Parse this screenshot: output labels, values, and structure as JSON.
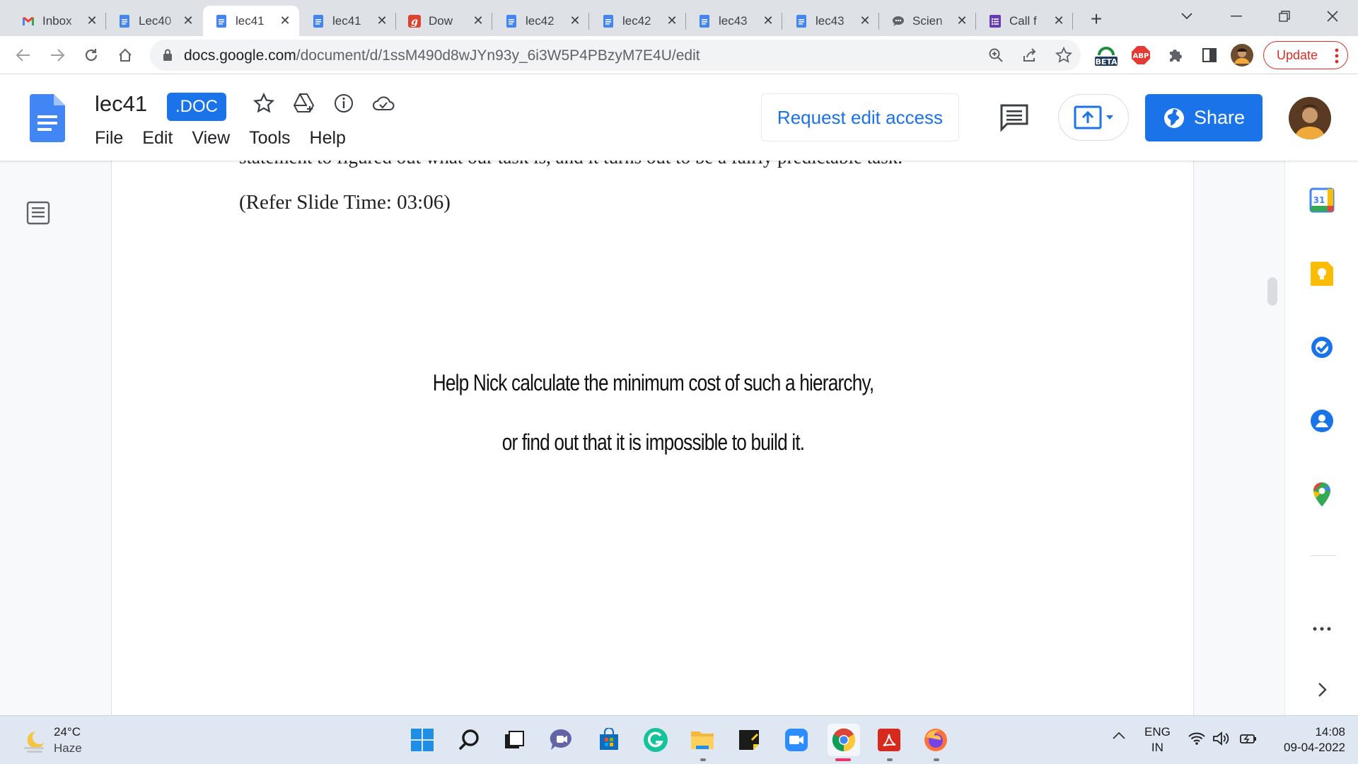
{
  "browser": {
    "tabs": [
      {
        "title": "Inbox",
        "favicon": "gmail-icon"
      },
      {
        "title": "Lec40",
        "favicon": "docs-icon"
      },
      {
        "title": "lec41",
        "favicon": "docs-icon",
        "active": true
      },
      {
        "title": "lec41",
        "favicon": "docs-icon"
      },
      {
        "title": "Dow",
        "favicon": "g-red-icon"
      },
      {
        "title": "lec42",
        "favicon": "docs-icon"
      },
      {
        "title": "lec42",
        "favicon": "docs-icon"
      },
      {
        "title": "lec43",
        "favicon": "docs-icon"
      },
      {
        "title": "lec43",
        "favicon": "docs-icon"
      },
      {
        "title": "Scien",
        "favicon": "chat-bubble-icon"
      },
      {
        "title": "Call f",
        "favicon": "forms-icon"
      }
    ],
    "url_host": "docs.google.com",
    "url_path": "/document/d/1ssM490d8wJYn93y_6i3W5P4PBzyM7E4U/edit",
    "extension_beta_label": "BETA",
    "extension_abp_label": "ABP",
    "update_label": "Update"
  },
  "docs": {
    "title": "lec41",
    "badge": ".DOC",
    "menu": [
      "File",
      "Edit",
      "View",
      "Tools",
      "Help"
    ],
    "request_edit_label": "Request edit access",
    "share_label": "Share"
  },
  "document": {
    "cut_line": "statement to figured out what our task is, and it turns out to be a fairly predictable task.",
    "refer_line": "(Refer Slide Time: 03:06)",
    "slide_line1": "Help Nick calculate the minimum cost of such a hierarchy,",
    "slide_line2": "or find out that it is impossible to build it."
  },
  "side_panel": {
    "calendar_day": "31"
  },
  "taskbar": {
    "weather_temp": "24°C",
    "weather_condition": "Haze",
    "lang_line1": "ENG",
    "lang_line2": "IN",
    "time": "14:08",
    "date": "09-04-2022"
  },
  "colors": {
    "accent_blue": "#1a73e8",
    "update_red": "#d93025",
    "tab_strip": "#dee1e6"
  }
}
